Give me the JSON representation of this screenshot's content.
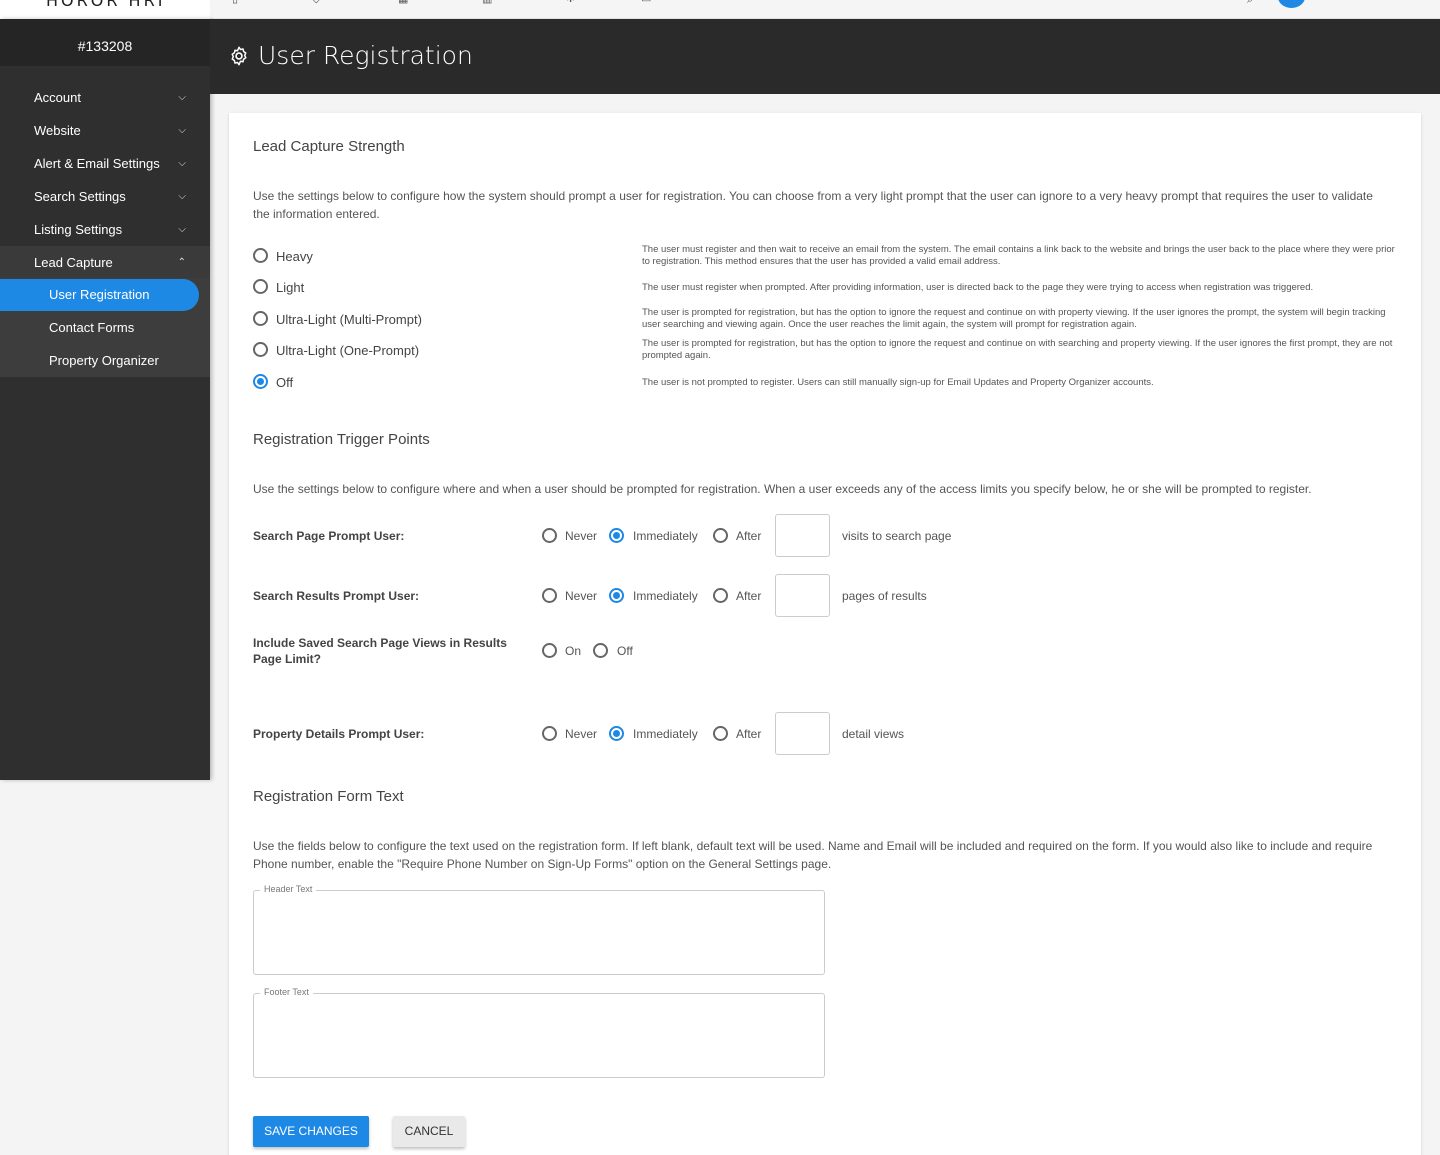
{
  "topbar": {
    "logo": "HOROR HRI"
  },
  "sidebar": {
    "account_id": "#133208",
    "items": [
      {
        "label": "Account"
      },
      {
        "label": "Website"
      },
      {
        "label": "Alert & Email Settings"
      },
      {
        "label": "Search Settings"
      },
      {
        "label": "Listing Settings"
      },
      {
        "label": "Lead Capture"
      }
    ],
    "sub_items": [
      {
        "label": "User Registration",
        "active": true
      },
      {
        "label": "Contact Forms"
      },
      {
        "label": "Property Organizer"
      }
    ]
  },
  "header": {
    "title": "User Registration",
    "icon": "gear-icon"
  },
  "lead_capture": {
    "title": "Lead Capture Strength",
    "description": "Use the settings below to configure how the system should prompt a user for registration. You can choose from a very light prompt that the user can ignore to a very heavy prompt that requires the user to validate the information entered.",
    "selected": "Off",
    "options": [
      {
        "label": "Heavy",
        "desc": "The user must register and then wait to receive an email from the system. The email contains a link back to the website and brings the user back to the place where they were prior to registration. This method ensures that the user has provided a valid email address."
      },
      {
        "label": "Light",
        "desc": "The user must register when prompted. After providing information, user is directed back to the page they were trying to access when registration was triggered."
      },
      {
        "label": "Ultra-Light (Multi-Prompt)",
        "desc": "The user is prompted for registration, but has the option to ignore the request and continue on with property viewing. If the user ignores the prompt, the system will begin tracking user searching and viewing again. Once the user reaches the limit again, the system will prompt for registration again."
      },
      {
        "label": "Ultra-Light (One-Prompt)",
        "desc": "The user is prompted for registration, but has the option to ignore the request and continue on with searching and property viewing. If the user ignores the first prompt, they are not prompted again."
      },
      {
        "label": "Off",
        "desc": "The user is not prompted to register. Users can still manually sign-up for Email Updates and Property Organizer accounts."
      }
    ]
  },
  "triggers": {
    "title": "Registration Trigger Points",
    "description": "Use the settings below to configure where and when a user should be prompted for registration. When a user exceeds any of the access limits you specify below, he or she will be prompted to register.",
    "choice_labels": {
      "never": "Never",
      "immediately": "Immediately",
      "after": "After",
      "on": "On",
      "off": "Off"
    },
    "search_page": {
      "label": "Search Page Prompt User:",
      "selected": "Immediately",
      "value": "",
      "suffix": "visits to search page"
    },
    "search_results": {
      "label": "Search Results Prompt User:",
      "selected": "Immediately",
      "value": "",
      "suffix": "pages of results"
    },
    "saved_search": {
      "label": "Include Saved Search Page Views in Results Page Limit?",
      "selected": ""
    },
    "property_details": {
      "label": "Property Details Prompt User:",
      "selected": "Immediately",
      "value": "",
      "suffix": "detail views"
    }
  },
  "form_text": {
    "title": "Registration Form Text",
    "description": "Use the fields below to configure the text used on the registration form. If left blank, default text will be used. Name and Email will be included and required on the form. If you would also like to include and require Phone number, enable the \"Require Phone Number on Sign-Up Forms\" option on the General Settings page.",
    "header_label": "Header Text",
    "header_value": "",
    "footer_label": "Footer Text",
    "footer_value": ""
  },
  "actions": {
    "save": "SAVE CHANGES",
    "cancel": "CANCEL"
  },
  "colors": {
    "accent": "#1e88e5",
    "sidebar": "#2f2f2f",
    "header": "#2a2a2a"
  }
}
